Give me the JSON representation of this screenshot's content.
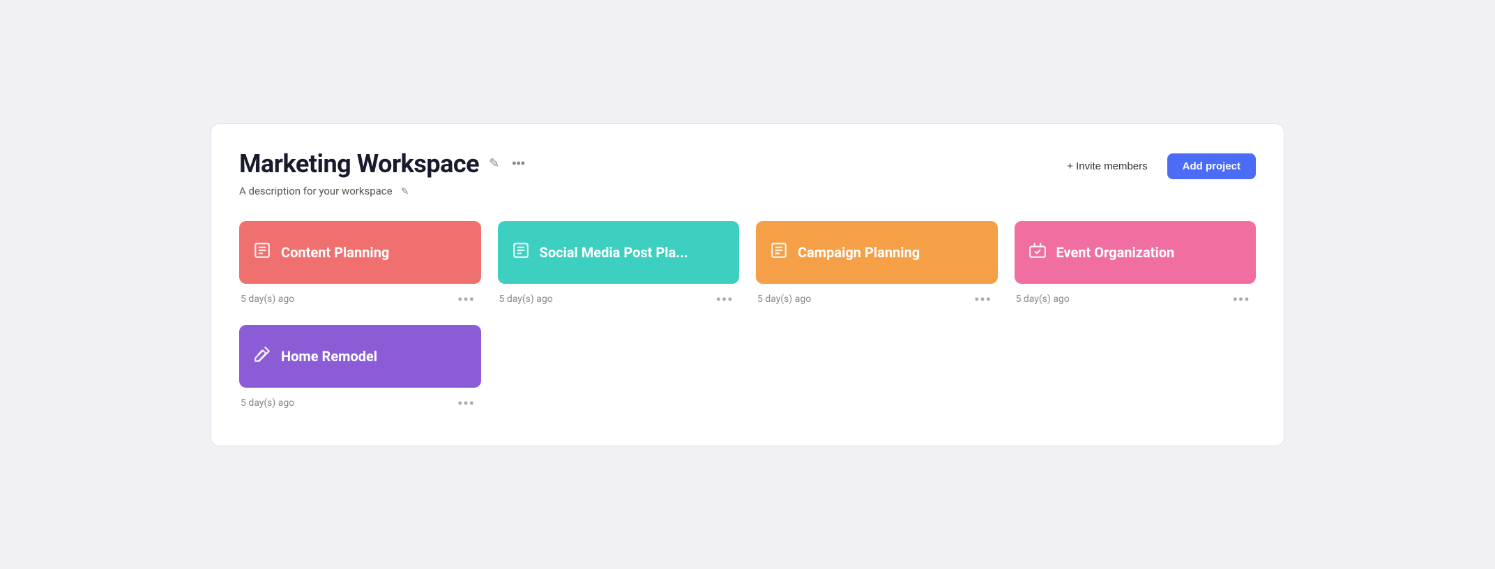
{
  "header": {
    "title": "Marketing Workspace",
    "description": "A description for your workspace",
    "invite_label": "+ Invite members",
    "add_project_label": "Add project"
  },
  "projects": [
    {
      "id": "content-planning",
      "title": "Content Planning",
      "time": "5 day(s) ago",
      "color_class": "card-salmon",
      "icon": "📋"
    },
    {
      "id": "social-media",
      "title": "Social Media Post Pla...",
      "time": "5 day(s) ago",
      "color_class": "card-teal",
      "icon": "📓"
    },
    {
      "id": "campaign-planning",
      "title": "Campaign Planning",
      "time": "5 day(s) ago",
      "color_class": "card-orange",
      "icon": "📔"
    },
    {
      "id": "event-organization",
      "title": "Event Organization",
      "time": "5 day(s) ago",
      "color_class": "card-pink",
      "icon": "🏷️"
    },
    {
      "id": "home-remodel",
      "title": "Home Remodel",
      "time": "5 day(s) ago",
      "color_class": "card-purple",
      "icon": "🔀"
    }
  ]
}
